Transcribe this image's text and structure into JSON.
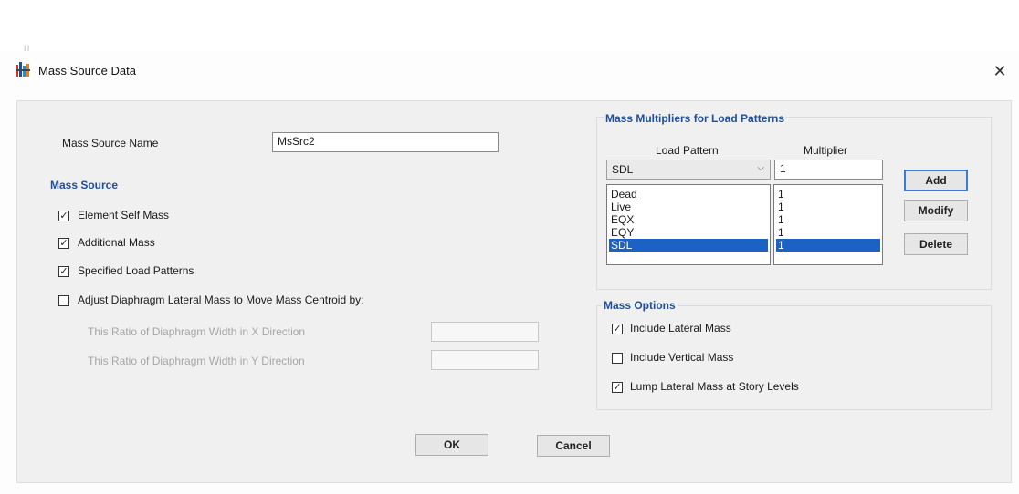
{
  "window": {
    "title": "Mass Source Data",
    "close_glyph": "✕"
  },
  "name_row": {
    "label": "Mass Source Name",
    "value": "MsSrc2"
  },
  "mass_source": {
    "title": "Mass Source",
    "options": [
      {
        "label": "Element Self Mass",
        "checked": true
      },
      {
        "label": "Additional Mass",
        "checked": true
      },
      {
        "label": "Specified Load Patterns",
        "checked": true
      },
      {
        "label": "Adjust Diaphragm Lateral Mass to Move Mass Centroid by:",
        "checked": false
      }
    ],
    "ratio_x_label": "This Ratio of Diaphragm Width in X Direction",
    "ratio_y_label": "This Ratio of Diaphragm Width in Y Direction",
    "ratio_x_value": "",
    "ratio_y_value": ""
  },
  "multipliers": {
    "title": "Mass Multipliers for Load Patterns",
    "col_pattern": "Load Pattern",
    "col_multiplier": "Multiplier",
    "selected_pattern": "SDL",
    "multiplier_value": "1",
    "rows": [
      {
        "pattern": "Dead",
        "multiplier": "1"
      },
      {
        "pattern": "Live",
        "multiplier": "1"
      },
      {
        "pattern": "EQX",
        "multiplier": "1"
      },
      {
        "pattern": "EQY",
        "multiplier": "1"
      },
      {
        "pattern": "SDL",
        "multiplier": "1",
        "selected": true
      }
    ],
    "add_label": "Add",
    "modify_label": "Modify",
    "delete_label": "Delete"
  },
  "mass_options": {
    "title": "Mass Options",
    "options": [
      {
        "label": "Include Lateral Mass",
        "checked": true
      },
      {
        "label": "Include Vertical Mass",
        "checked": false
      },
      {
        "label": "Lump Lateral Mass at Story Levels",
        "checked": true
      }
    ]
  },
  "footer": {
    "ok_label": "OK",
    "cancel_label": "Cancel"
  },
  "colors": {
    "accent": "#1f4e9a",
    "selection": "#1c61c4"
  },
  "icons": {
    "title": "app-icon",
    "close": "close-icon",
    "combo": "chevron-down-icon",
    "check": "check-icon"
  }
}
